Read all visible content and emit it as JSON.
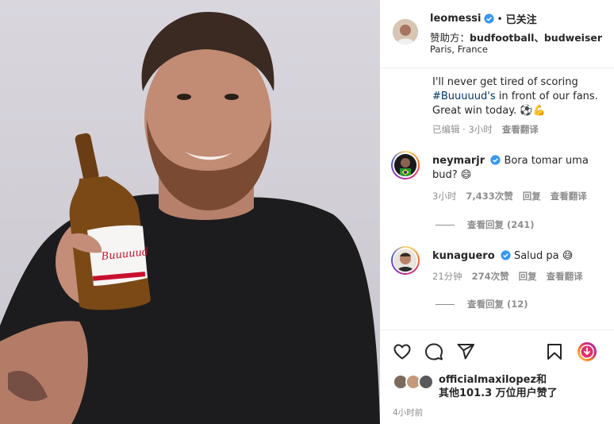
{
  "post": {
    "username": "leomessi",
    "follow_state": "已关注",
    "separator": "•",
    "sponsor_label": "赞助方：",
    "sponsor_names": "budfootball、budweiser",
    "location": "Paris, France"
  },
  "caption": {
    "text_before_hashtag": "I'll never get tired of scoring ",
    "hashtag": "#Buuuuud's",
    "text_after_hashtag": " in front of our fans. Great win today. ",
    "emojis": "⚽💪",
    "edited": "已编辑",
    "time": "3小时",
    "translate": "查看翻译"
  },
  "comments": [
    {
      "username": "neymarjr",
      "text": "Bora tomar uma bud? ",
      "emoji": "😄",
      "time": "3小时",
      "likes": "7,433次赞",
      "reply": "回复",
      "translate": "查看翻译",
      "view_replies": "查看回复 (241)"
    },
    {
      "username": "kunaguero",
      "text": "Salud pa ",
      "emoji": "😅",
      "time": "21分钟",
      "likes": "274次赞",
      "reply": "回复",
      "translate": "查看翻译",
      "view_replies": "查看回复 (12)"
    }
  ],
  "likes": {
    "line1": "officialmaxilopez和",
    "line2": "其他101.3 万位用户赞了"
  },
  "timestamp": "4小时前",
  "icons": {
    "like": "heart-icon",
    "comment": "comment-icon",
    "share": "share-icon",
    "save": "bookmark-icon",
    "reel": "reel-icon"
  },
  "colors": {
    "verified": "#3897f0",
    "hashtag": "#00376b",
    "muted": "#8e8e8e"
  }
}
